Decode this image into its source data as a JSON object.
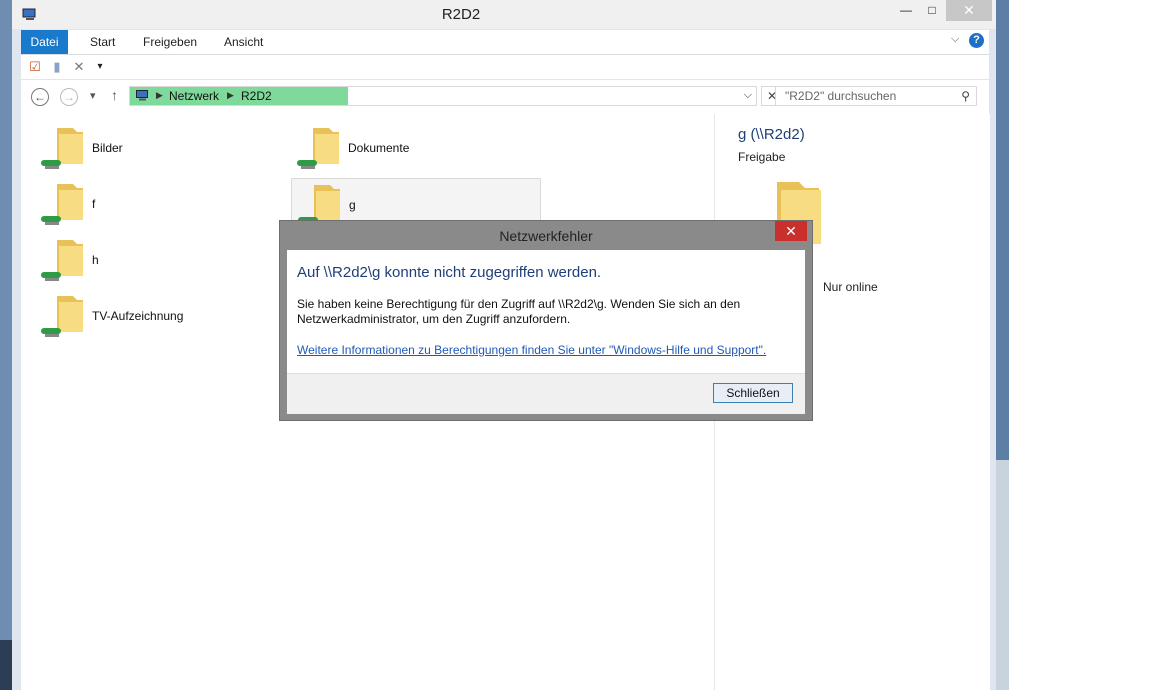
{
  "window": {
    "title": "R2D2",
    "minimize": "—",
    "maximize": "□",
    "close": "✕"
  },
  "ribbon": {
    "tabs": [
      "Datei",
      "Start",
      "Freigeben",
      "Ansicht"
    ],
    "expand_icon": "chevron-down-icon",
    "help": "?"
  },
  "navigation": {
    "back": "←",
    "forward": "→",
    "recent": "▾",
    "up": "↑",
    "breadcrumb": [
      "Netzwerk",
      "R2D2"
    ],
    "clear": "✕",
    "search_placeholder": "\"R2D2\" durchsuchen"
  },
  "items": [
    {
      "name": "Bilder"
    },
    {
      "name": "Dokumente"
    },
    {
      "name": "f"
    },
    {
      "name": "g"
    },
    {
      "name": "h"
    },
    {
      "name": "TV-Aufzeichnung"
    }
  ],
  "details": {
    "title": "g (\\\\R2d2)",
    "subtitle": "Freigabe",
    "status": "Nur online"
  },
  "dialog": {
    "title": "Netzwerkfehler",
    "close": "✕",
    "heading": "Auf \\\\R2d2\\g konnte nicht zugegriffen werden.",
    "message": "Sie haben keine Berechtigung für den Zugriff auf \\\\R2d2\\g. Wenden Sie sich an den Netzwerkadministrator, um den Zugriff anzufordern.",
    "link": "Weitere Informationen zu Berechtigungen finden Sie unter \"Windows-Hilfe und Support\".",
    "button": "Schließen"
  },
  "colors": {
    "file_tab": "#1979ca",
    "address_highlight": "#7fd99a",
    "heading_blue": "#1e3f78",
    "dialog_close": "#c9302c"
  }
}
